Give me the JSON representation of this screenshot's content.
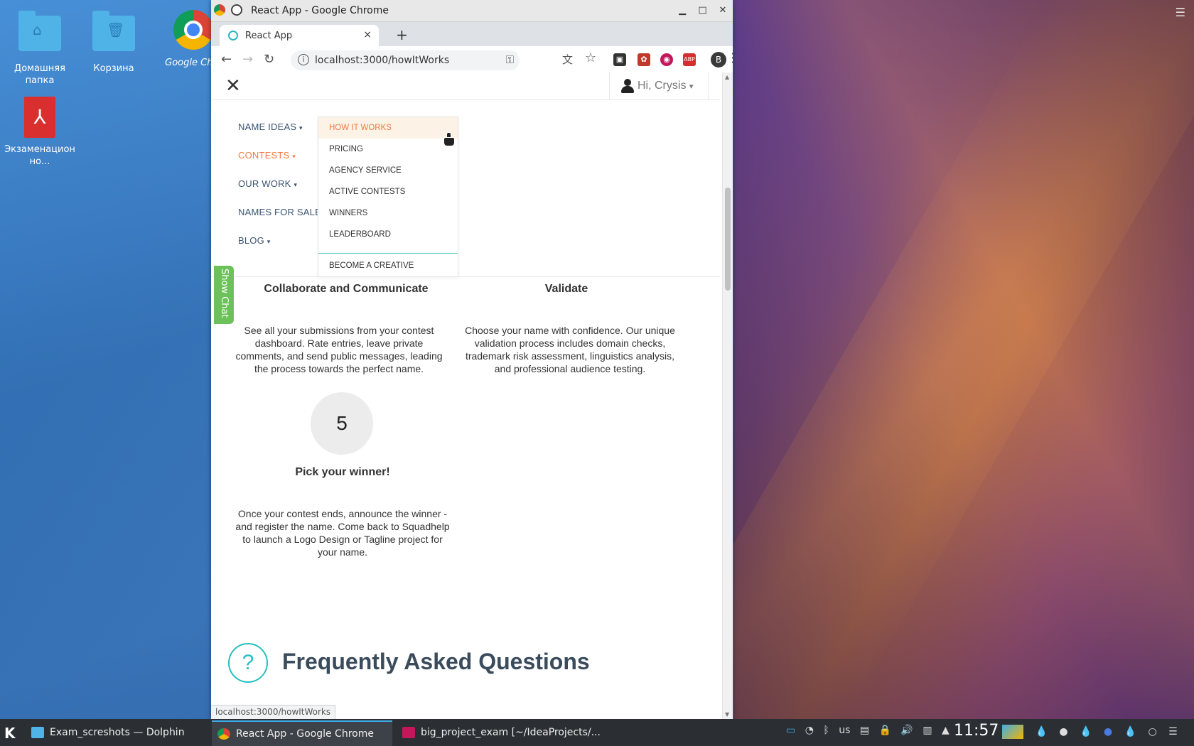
{
  "desktop": {
    "icons": [
      {
        "label": "Домашняя папка",
        "icon": "home-folder-icon"
      },
      {
        "label": "Корзина",
        "icon": "trash-icon"
      },
      {
        "label": "Google Ch...",
        "icon": "chrome-icon"
      },
      {
        "label": "Экзаменацион но...",
        "icon": "pdf-icon"
      }
    ]
  },
  "window": {
    "title": "React App - Google Chrome",
    "controls": [
      "minimize-icon",
      "maximize-icon",
      "close-icon"
    ]
  },
  "browser": {
    "tab_title": "React App",
    "tab_close": "×",
    "new_tab": "+",
    "url": "localhost:3000/howItWorks",
    "profile_initial": "B",
    "extensions": [
      {
        "name": "ext-box-icon",
        "badge": "1"
      },
      {
        "name": "ext-red-icon",
        "badge": ""
      },
      {
        "name": "ext-circle-icon",
        "badge": ""
      },
      {
        "name": "ext-abp-icon",
        "badge": "4"
      }
    ]
  },
  "header": {
    "close": "✕",
    "greeting": "Hi, Crysis",
    "caret": "▾"
  },
  "menu": {
    "items": [
      {
        "label": "NAME IDEAS",
        "caret": "▾",
        "active": false
      },
      {
        "label": "CONTESTS",
        "caret": "▾",
        "active": true
      },
      {
        "label": "OUR WORK",
        "caret": "▾",
        "active": false
      },
      {
        "label": "NAMES FOR SALE",
        "caret": "",
        "active": false
      },
      {
        "label": "BLOG",
        "caret": "▾",
        "active": false
      }
    ],
    "dropdown": [
      {
        "label": "HOW IT WORKS",
        "hover": true
      },
      {
        "label": "PRICING"
      },
      {
        "label": "AGENCY SERVICE"
      },
      {
        "label": "ACTIVE CONTESTS"
      },
      {
        "label": "WINNERS"
      },
      {
        "label": "LEADERBOARD"
      },
      {
        "label": "BECOME A CREATIVE"
      }
    ]
  },
  "chat": {
    "label": "Show Chat"
  },
  "steps": [
    {
      "title": "Collaborate and Communicate",
      "text": "See all your submissions from your contest dashboard. Rate entries, leave private comments, and send public messages, leading the process towards the perfect name."
    },
    {
      "title": "Validate",
      "text": "Choose your name with confidence. Our unique validation process includes domain checks, trademark risk assessment, linguistics analysis, and professional audience testing."
    },
    {
      "number": "5",
      "title": "Pick your winner!",
      "text": "Once your contest ends, announce the winner - and register the name. Come back to Squadhelp to launch a Logo Design or Tagline project for your name."
    }
  ],
  "faq": {
    "icon": "?",
    "title": "Frequently Asked Questions"
  },
  "status_url": "localhost:3000/howItWorks",
  "taskbar": {
    "tasks": [
      {
        "label": "Exam_screshots — Dolphin",
        "active": false
      },
      {
        "label": "React App - Google Chrome",
        "active": true
      },
      {
        "label": "big_project_exam [~/IdeaProjects/...",
        "active": false
      }
    ],
    "keyboard_layout": "us",
    "clock": "11:57"
  },
  "colors": {
    "accent": "#f07a42",
    "nav_text": "#3a5474",
    "chat": "#6cc15a",
    "faq": "#27bfbf",
    "divider": "#4ec7b6"
  }
}
